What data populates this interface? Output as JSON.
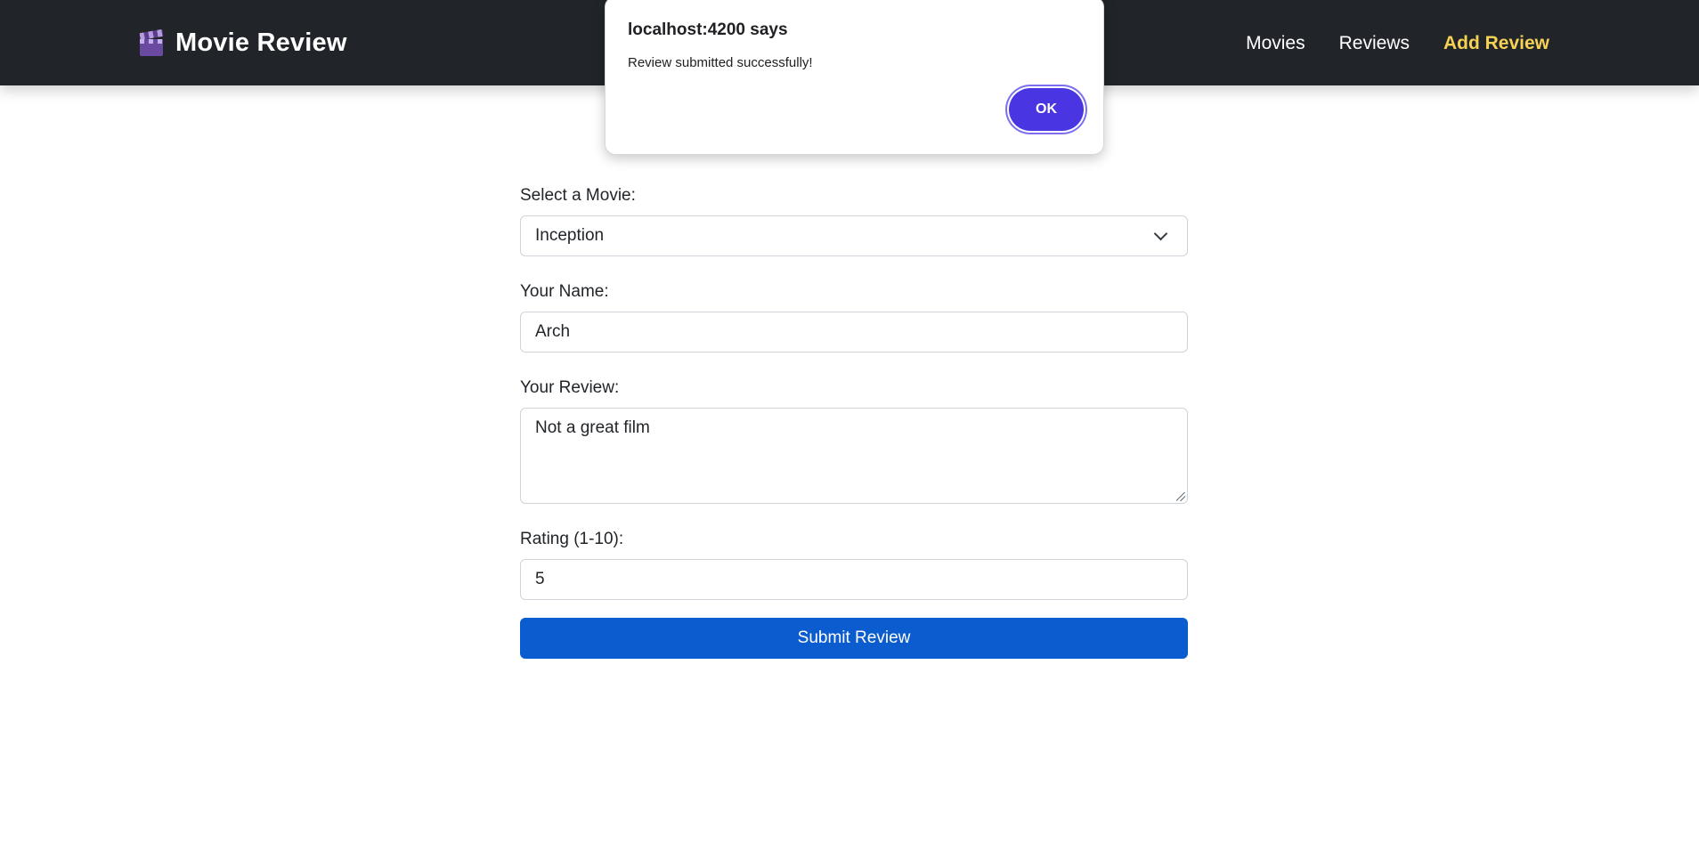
{
  "navbar": {
    "brand_icon": "clapperboard-icon",
    "brand_title": "Movie Review",
    "links": [
      {
        "label": "Movies"
      },
      {
        "label": "Reviews"
      },
      {
        "label": "Add Review",
        "active": true
      }
    ],
    "accent_color": "#f7d154",
    "background_color": "#212529"
  },
  "form": {
    "movie_label": "Select a Movie:",
    "movie_value": "Inception",
    "name_label": "Your Name:",
    "name_value": "Arch",
    "review_label": "Your Review:",
    "review_value": "Not a great film",
    "rating_label": "Rating (1-10):",
    "rating_value": "5",
    "submit_label": "Submit Review",
    "submit_color": "#0b5ccf"
  },
  "dialog": {
    "title": "localhost:4200 says",
    "message": "Review submitted successfully!",
    "ok_label": "OK",
    "ok_color": "#4a35e3"
  }
}
